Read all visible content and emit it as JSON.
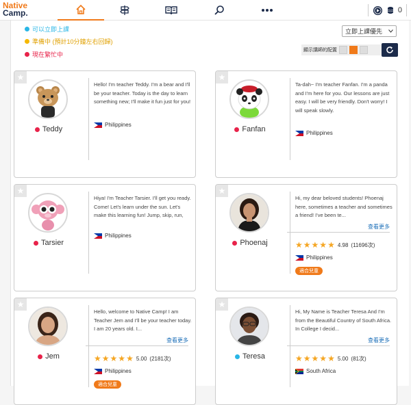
{
  "header": {
    "logo_line1": "Native",
    "logo_line2": "Camp.",
    "nav": [
      "home-icon",
      "signpost-icon",
      "book-icon",
      "search-icon",
      "more-icon"
    ],
    "coins": "0"
  },
  "legend": [
    {
      "label": "可以立即上課",
      "color": "#29b6e6"
    },
    {
      "label": "準備中 (預計10分鐘左右回歸)",
      "color": "#f5b800"
    },
    {
      "label": "現在繁忙中",
      "color": "#e8234a"
    }
  ],
  "sort": {
    "selected": "立即上課優先"
  },
  "layout": {
    "label": "顯示講師的配置"
  },
  "teachers": [
    {
      "name": "Teddy",
      "status_color": "#e8234a",
      "bio": "Hello! I'm teacher Teddy. I'm a bear and I'll be your teacher. Today is the day to learn something new; I'll make it fun just for you! In my class",
      "country": "Philippines",
      "rating": null,
      "review_count": null,
      "more": null,
      "badge": null,
      "avatar": "bear"
    },
    {
      "name": "Fanfan",
      "status_color": "#e8234a",
      "bio": "Ta-dah~ I'm teacher Fanfan. I'm a panda and I'm here for you. Our lessons are just easy. I will be very friendly. Don't worry! I will speak slowly.",
      "country": "Philippines",
      "rating": null,
      "review_count": null,
      "more": null,
      "badge": null,
      "avatar": "panda"
    },
    {
      "name": "Tarsier",
      "status_color": "#e8234a",
      "bio": "Hiya! I'm Teacher Tarsier. I'll get you ready. Come! Let's learn under the sun. Let's make this learning fun! Jump, skip, run, and hop. I'll help yo",
      "country": "Philippines",
      "rating": null,
      "review_count": null,
      "more": null,
      "badge": null,
      "avatar": "monkey"
    },
    {
      "name": "Phoenaj",
      "status_color": "#e8234a",
      "bio": "Hi, my dear beloved students! Phoenaj here, sometimes a teacher and sometimes a friend! I've been te...",
      "country": "Philippines",
      "rating": "4.98",
      "review_count": "(11696次)",
      "more": "查看更多",
      "badge": "適合兒童",
      "avatar": "woman1"
    },
    {
      "name": "Jem",
      "status_color": "#e8234a",
      "bio": "Hello, welcome to Native Camp! I am Teacher Jem and I'll be your teacher today. I am 20 years old. I...",
      "country": "Philippines",
      "rating": "5.00",
      "review_count": "(2181次)",
      "more": "查看更多",
      "badge": "適合兒童",
      "avatar": "woman2"
    },
    {
      "name": "Teresa",
      "status_color": "#29b6e6",
      "bio": "Hi, My Name is Teacher Teresa And I'm from the Beautiful Country of South Africa. In College I decid...",
      "country": "South Africa",
      "rating": "5.00",
      "review_count": "(81次)",
      "more": "查看更多",
      "badge": null,
      "avatar": "woman3"
    }
  ]
}
